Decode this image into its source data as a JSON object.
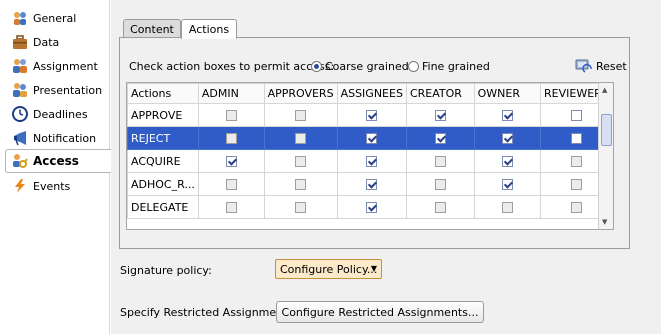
{
  "sidebar": {
    "items": [
      {
        "label": "General",
        "icon": "people-icon"
      },
      {
        "label": "Data",
        "icon": "briefcase-icon"
      },
      {
        "label": "Assignment",
        "icon": "people-icon"
      },
      {
        "label": "Presentation",
        "icon": "people-icon"
      },
      {
        "label": "Deadlines",
        "icon": "clock-icon"
      },
      {
        "label": "Notification",
        "icon": "megaphone-icon"
      },
      {
        "label": "Access",
        "icon": "key-people-icon",
        "active": true
      },
      {
        "label": "Events",
        "icon": "lightning-icon"
      }
    ]
  },
  "tabs": [
    {
      "label": "Content",
      "active": false
    },
    {
      "label": "Actions",
      "active": true
    }
  ],
  "access": {
    "prompt": "Check action boxes to permit access:",
    "coarse_label": "Coarse grained",
    "fine_label": "Fine grained",
    "selected_mode": "coarse",
    "reset_label": "Reset"
  },
  "table": {
    "columns": [
      "Actions",
      "ADMIN",
      "APPROVERS",
      "ASSIGNEES",
      "CREATOR",
      "OWNER",
      "REVIEWERS"
    ],
    "rows": [
      {
        "action": "APPROVE",
        "checks": [
          false,
          false,
          true,
          true,
          true,
          false
        ],
        "enabled": [
          false,
          false,
          true,
          true,
          true,
          true
        ],
        "selected": false
      },
      {
        "action": "REJECT",
        "checks": [
          false,
          false,
          true,
          true,
          true,
          false
        ],
        "enabled": [
          false,
          false,
          true,
          true,
          true,
          true
        ],
        "selected": true
      },
      {
        "action": "ACQUIRE",
        "checks": [
          true,
          false,
          true,
          false,
          true,
          false
        ],
        "enabled": [
          true,
          false,
          true,
          false,
          true,
          false
        ],
        "selected": false
      },
      {
        "action": "ADHOC_R...",
        "checks": [
          false,
          false,
          true,
          false,
          true,
          false
        ],
        "enabled": [
          false,
          false,
          true,
          false,
          true,
          false
        ],
        "selected": false
      },
      {
        "action": "DELEGATE",
        "checks": [
          false,
          false,
          true,
          false,
          false,
          false
        ],
        "enabled": [
          false,
          false,
          true,
          false,
          false,
          false
        ],
        "selected": false
      }
    ]
  },
  "signature": {
    "label": "Signature policy:",
    "dropdown_value": "Configure Policy..."
  },
  "restricted": {
    "label": "Specify Restricted Assignment",
    "button_label": "Configure Restricted Assignments..."
  },
  "colors": {
    "selected_row": "#2f5cc6",
    "dropdown_bg": "#fbe9c9",
    "check_mark": "#2a3f8a"
  }
}
